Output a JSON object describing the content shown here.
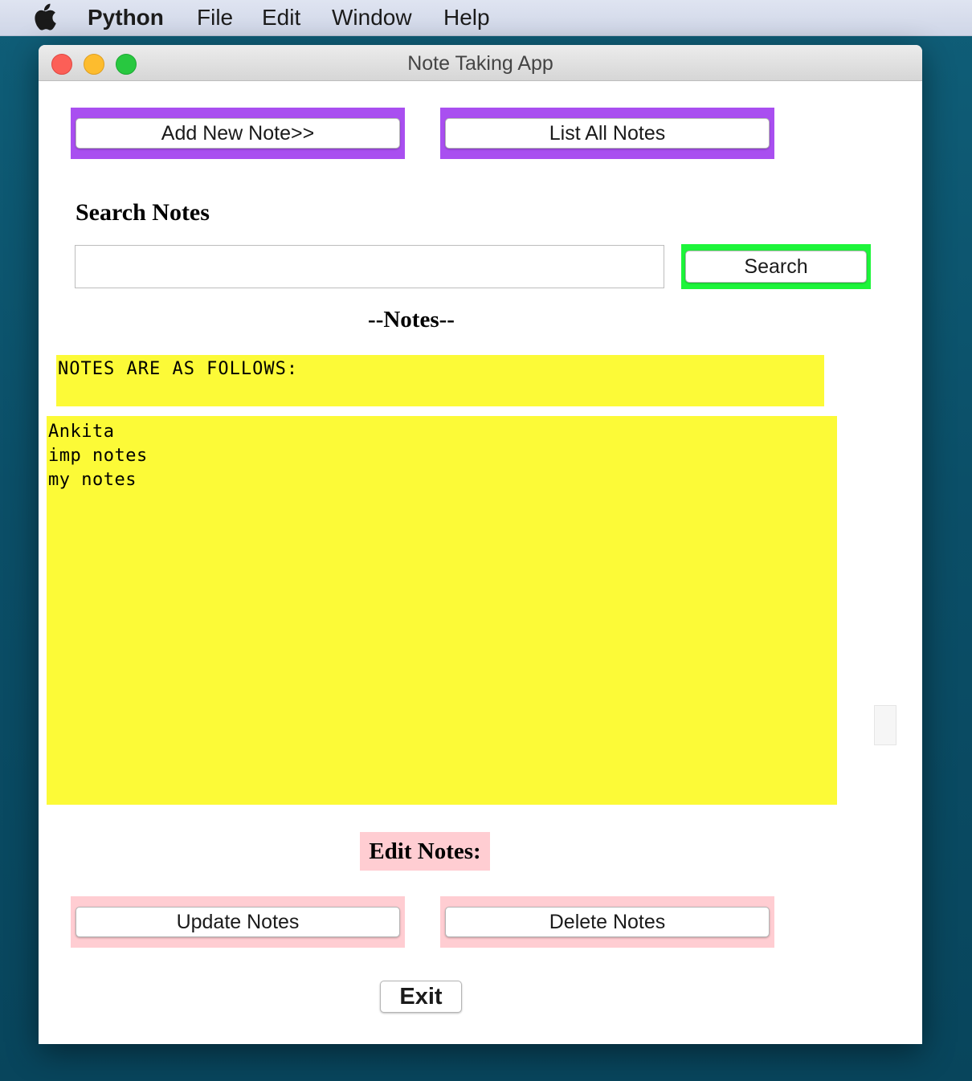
{
  "menubar": {
    "app_name": "Python",
    "items": [
      "File",
      "Edit",
      "Window",
      "Help"
    ]
  },
  "window": {
    "title": "Note Taking App"
  },
  "toolbar": {
    "add_note_label": "Add New Note>>",
    "list_notes_label": "List All Notes",
    "frame_color": "#a94ff0"
  },
  "search": {
    "title": "Search Notes",
    "input_value": "",
    "button_label": "Search",
    "button_frame_color": "#1df53a"
  },
  "notes": {
    "heading": "--Notes--",
    "header_text": "NOTES ARE AS FOLLOWS:",
    "items": [
      "Ankita",
      "imp notes",
      "my notes"
    ],
    "background_color": "#fcfa37"
  },
  "edit": {
    "label": "Edit Notes:",
    "update_label": "Update Notes",
    "delete_label": "Delete Notes",
    "frame_color": "#ffcdd2"
  },
  "exit_label": "Exit"
}
